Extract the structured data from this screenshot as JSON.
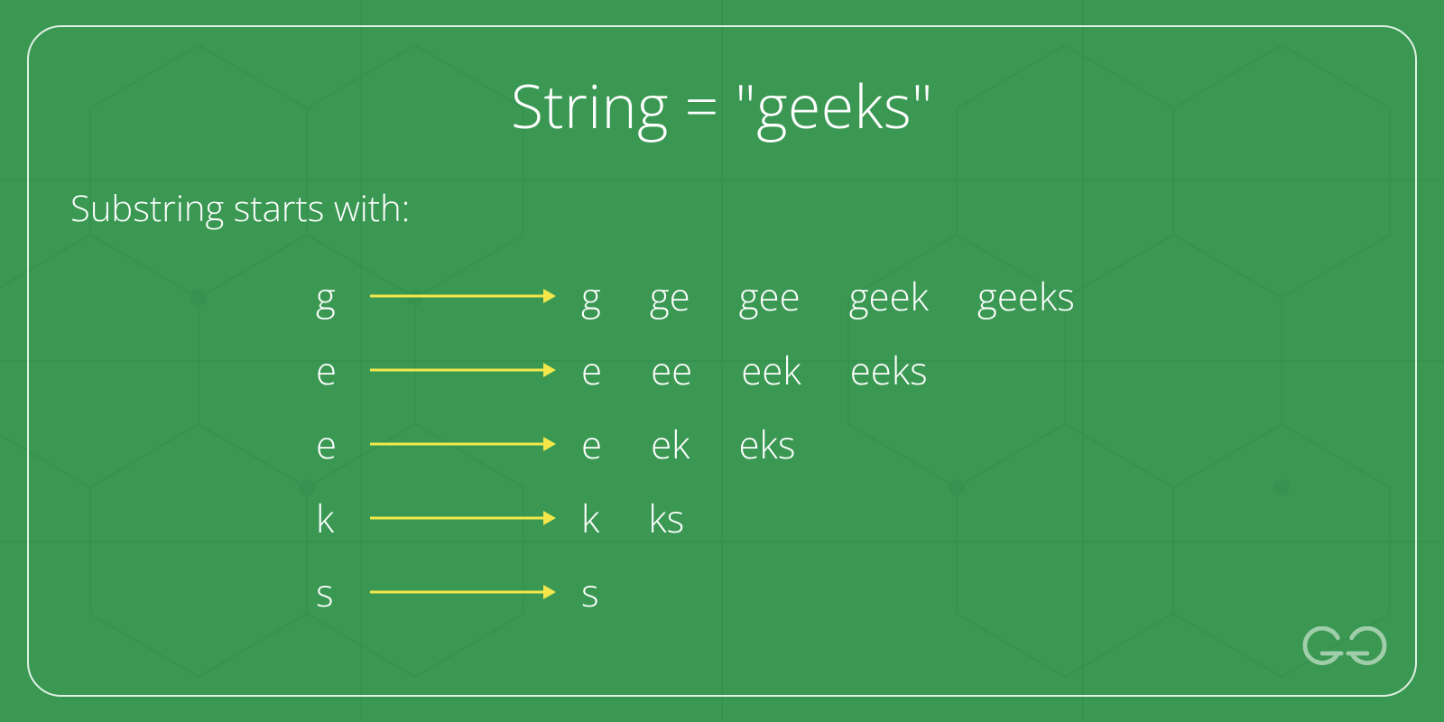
{
  "title": "String = \"geeks\"",
  "subtitle": "Substring starts  with:",
  "rows": [
    {
      "char": "g",
      "subs": [
        "g",
        "ge",
        "gee",
        "geek",
        "geeks"
      ]
    },
    {
      "char": "e",
      "subs": [
        "e",
        "ee",
        "eek",
        "eeks"
      ]
    },
    {
      "char": "e",
      "subs": [
        "e",
        "ek",
        "eks"
      ]
    },
    {
      "char": "k",
      "subs": [
        "k",
        "ks"
      ]
    },
    {
      "char": "s",
      "subs": [
        "s"
      ]
    }
  ],
  "colors": {
    "background": "#3a9853",
    "text": "#ffffff",
    "arrow": "#f3e74b",
    "border": "#ffffff"
  },
  "logo_name": "GG"
}
